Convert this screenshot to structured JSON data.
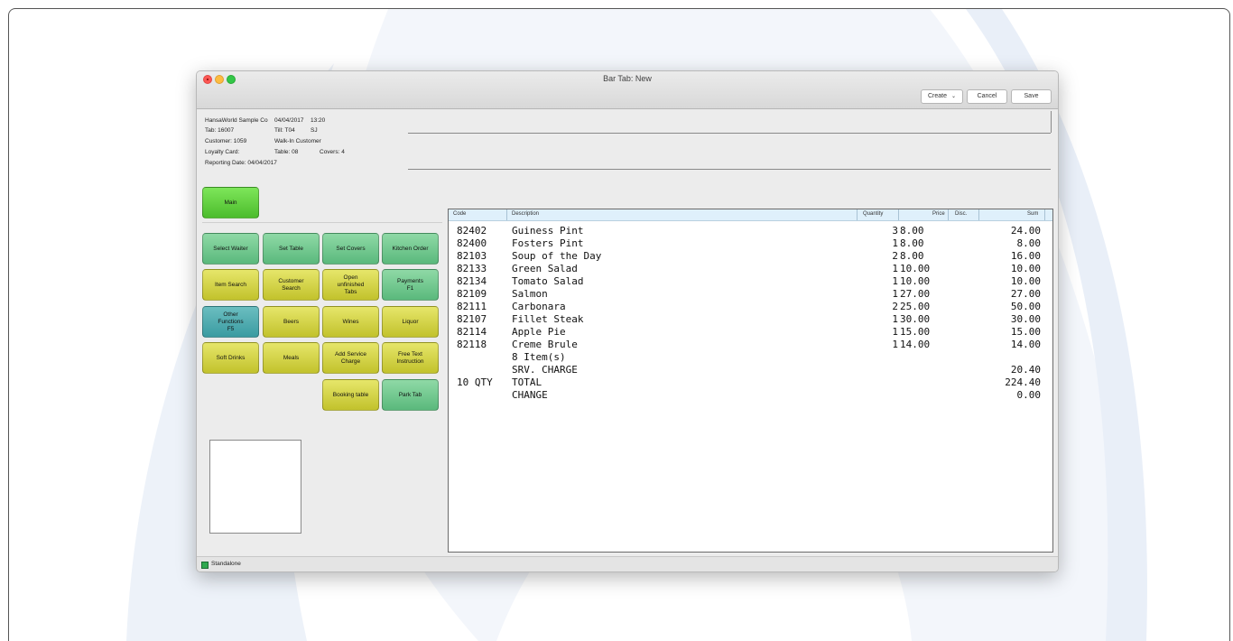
{
  "window": {
    "title": "Bar Tab: New",
    "toolbar": {
      "create_label": "Create",
      "cancel_label": "Cancel",
      "save_label": "Save"
    }
  },
  "header": {
    "company": "HansaWorld Sample Co",
    "date": "04/04/2017",
    "time": "13:20",
    "tab": "Tab: 16007",
    "till": "Till: T04",
    "user": "SJ",
    "customer": "Customer: 1059",
    "customer_name": "Walk-In Customer",
    "loyalty_card": "Loyalty Card:",
    "table": "Table: 08",
    "covers": "Covers: 4",
    "reporting_date": "Reporting Date: 04/04/2017"
  },
  "main_button": "Main",
  "buttons": {
    "select_waiter": "Select Waiter",
    "set_table": "Set Table",
    "set_covers": "Set Covers",
    "kitchen_order": "Kitchen Order",
    "item_search": "Item Search",
    "customer_search_1": "Customer",
    "customer_search_2": "Search",
    "open_tabs_1": "Open",
    "open_tabs_2": "unfinished",
    "open_tabs_3": "Tabs",
    "payments_1": "Payments",
    "payments_2": "F1",
    "other_1": "Other",
    "other_2": "Functions",
    "other_3": "F5",
    "beers": "Beers",
    "wines": "Wines",
    "liquor": "Liquor",
    "soft_drinks": "Soft Drinks",
    "meals": "Meals",
    "add_service_1": "Add Service",
    "add_service_2": "Charge",
    "free_text_1": "Free Text",
    "free_text_2": "Instruction",
    "booking_table": "Booking table",
    "park_tab": "Park Tab"
  },
  "grid": {
    "headers": {
      "code": "Code",
      "description": "Description",
      "quantity": "Quantity",
      "price": "Price",
      "disc": "Disc.",
      "sum": "Sum"
    },
    "rows": [
      {
        "code": "82402",
        "desc": "Guiness Pint",
        "qty": "3",
        "price": "8.00",
        "sum": "24.00"
      },
      {
        "code": "82400",
        "desc": "Fosters Pint",
        "qty": "1",
        "price": "8.00",
        "sum": "8.00"
      },
      {
        "code": "82103",
        "desc": "Soup of the Day",
        "qty": "2",
        "price": "8.00",
        "sum": "16.00"
      },
      {
        "code": "82133",
        "desc": "Green Salad",
        "qty": "1",
        "price": "10.00",
        "sum": "10.00"
      },
      {
        "code": "82134",
        "desc": "Tomato Salad",
        "qty": "1",
        "price": "10.00",
        "sum": "10.00"
      },
      {
        "code": "82109",
        "desc": "Salmon",
        "qty": "1",
        "price": "27.00",
        "sum": "27.00"
      },
      {
        "code": "82111",
        "desc": "Carbonara",
        "qty": "2",
        "price": "25.00",
        "sum": "50.00"
      },
      {
        "code": "82107",
        "desc": "Fillet Steak",
        "qty": "1",
        "price": "30.00",
        "sum": "30.00"
      },
      {
        "code": "82114",
        "desc": "Apple Pie",
        "qty": "1",
        "price": "15.00",
        "sum": "15.00"
      },
      {
        "code": "82118",
        "desc": "Creme Brule",
        "qty": "1",
        "price": "14.00",
        "sum": "14.00"
      },
      {
        "code": "",
        "desc": "8 Item(s)",
        "qty": "",
        "price": "",
        "sum": ""
      },
      {
        "code": "",
        "desc": "SRV. CHARGE",
        "qty": "",
        "price": "",
        "sum": "20.40"
      },
      {
        "code": "10 QTY",
        "desc": "TOTAL",
        "qty": "",
        "price": "",
        "sum": "224.40"
      },
      {
        "code": "",
        "desc": "CHANGE",
        "qty": "",
        "price": "",
        "sum": "0.00"
      }
    ]
  },
  "status": {
    "text": "Standalone"
  }
}
